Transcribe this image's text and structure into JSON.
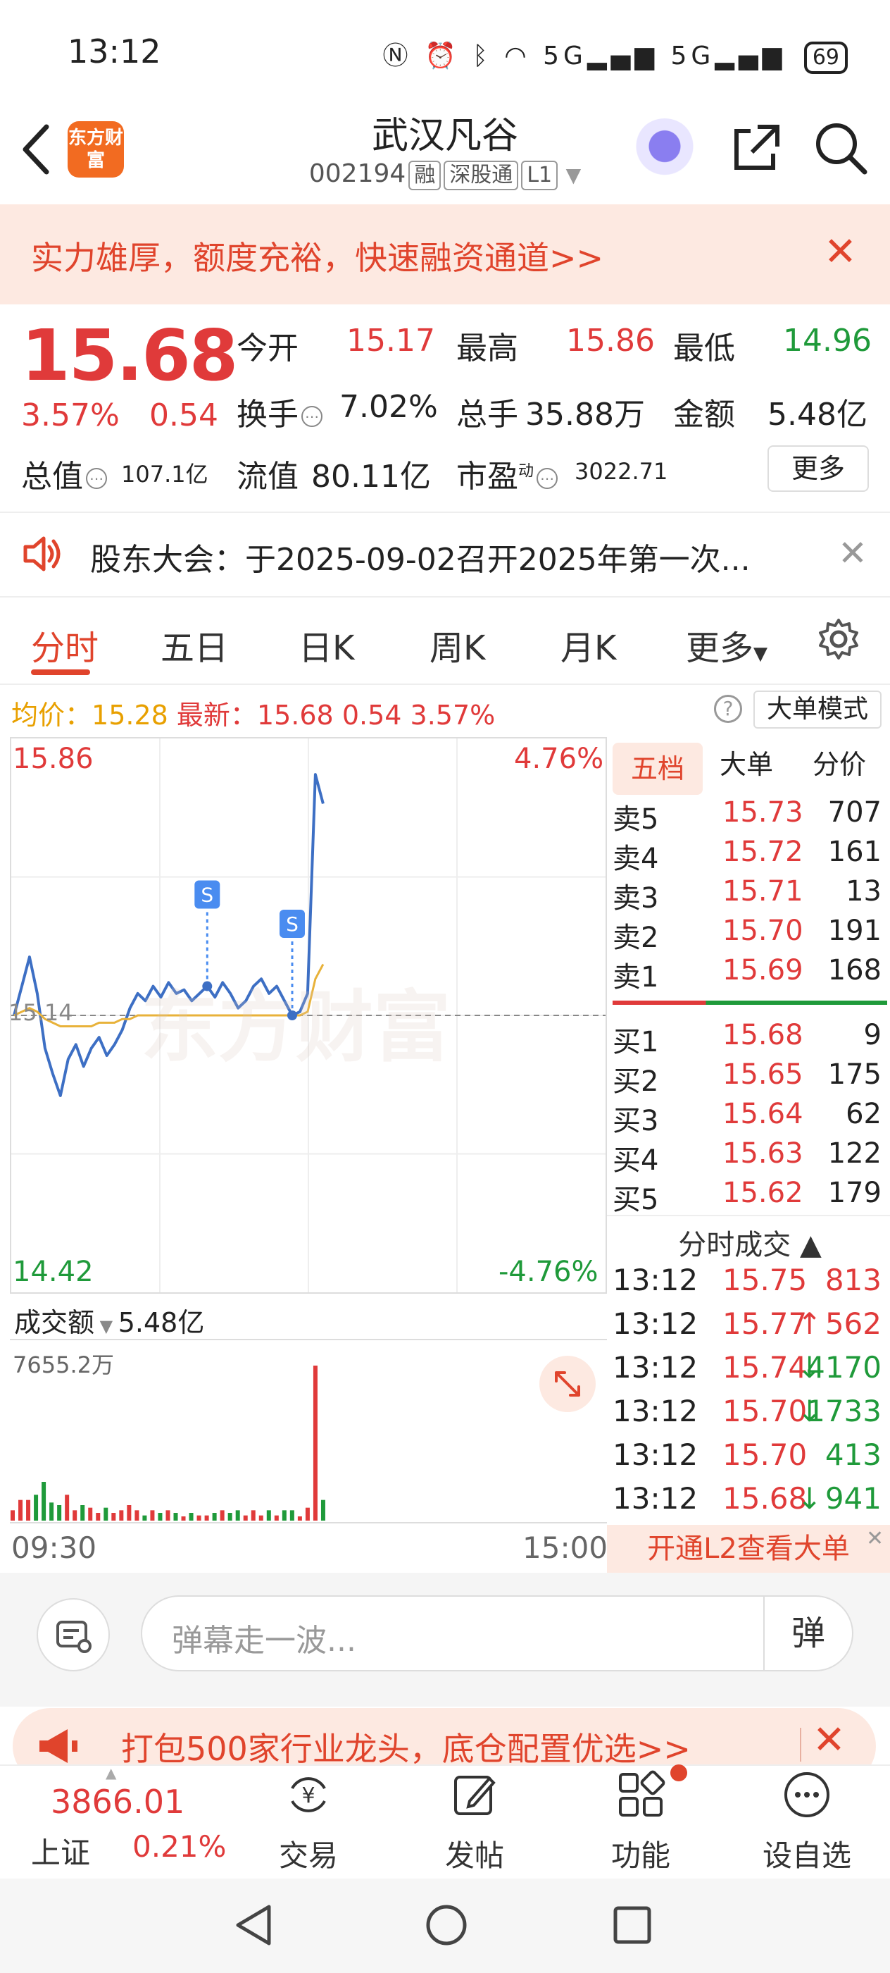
{
  "status_bar": {
    "time": "13:12",
    "battery": "69",
    "network": "5G"
  },
  "header": {
    "stock_name": "武汉凡谷",
    "code": "002194",
    "tags": [
      "融",
      "深股通",
      "L1"
    ],
    "logo_text": "东方财富"
  },
  "banner": {
    "text": "实力雄厚，额度充裕，快速融资通道>>"
  },
  "quote": {
    "price": "15.68",
    "pct": "3.57%",
    "change": "0.54",
    "open_label": "今开",
    "open": "15.17",
    "high_label": "最高",
    "high": "15.86",
    "low_label": "最低",
    "low": "14.96",
    "turnover_label": "换手",
    "turnover": "7.02%",
    "volume_label": "总手",
    "volume": "35.88万",
    "amount_label": "金额",
    "amount": "5.48亿",
    "mcap_label": "总值",
    "mcap": "107.1亿",
    "float_label": "流值",
    "float": "80.11亿",
    "pe_label": "市盈",
    "pe_sup": "动",
    "pe": "3022.71",
    "more": "更多"
  },
  "notice": {
    "text": "股东大会：于2025-09-02召开2025年第一次..."
  },
  "tabs": [
    "分时",
    "五日",
    "日K",
    "周K",
    "月K",
    "更多"
  ],
  "info_line": {
    "avg_label": "均价：",
    "avg": "15.28",
    "latest_label": "最新：",
    "latest": "15.68",
    "change": "0.54",
    "pct": "3.57%",
    "help": "?",
    "mode": "大单模式"
  },
  "chart": {
    "y_high": "15.86",
    "y_low": "14.42",
    "pct_high": "4.76%",
    "pct_low": "-4.76%",
    "ref": "15.14",
    "watermark": "东方财富",
    "marker": "S",
    "time_start": "09:30",
    "time_end": "15:00"
  },
  "chart_data": {
    "type": "line",
    "title": "",
    "xlabel": "",
    "ylabel": "",
    "x_range": [
      "09:30",
      "15:00"
    ],
    "ylim": [
      14.42,
      15.86
    ],
    "reference": 15.14,
    "series": [
      {
        "values": [
          15.14,
          15.22,
          15.3,
          15.2,
          15.05,
          14.98,
          14.92,
          15.02,
          15.06,
          15.0,
          15.05,
          15.08,
          15.03,
          15.06,
          15.1,
          15.16,
          15.2,
          15.18,
          15.22,
          15.19,
          15.23,
          15.2,
          15.21,
          15.18,
          15.2,
          15.22,
          15.19,
          15.23,
          15.2,
          15.16,
          15.18,
          15.22,
          15.24,
          15.2,
          15.22,
          15.18,
          15.14,
          15.15,
          15.2,
          15.8,
          15.72
        ]
      },
      {
        "values": [
          15.14,
          15.15,
          15.16,
          15.15,
          15.13,
          15.12,
          15.11,
          15.11,
          15.11,
          15.11,
          15.11,
          15.12,
          15.12,
          15.12,
          15.13,
          15.13,
          15.14,
          15.14,
          15.14,
          15.14,
          15.14,
          15.14,
          15.14,
          15.14,
          15.14,
          15.14,
          15.14,
          15.14,
          15.14,
          15.14,
          15.14,
          15.14,
          15.14,
          15.14,
          15.14,
          15.14,
          15.14,
          15.14,
          15.15,
          15.24,
          15.28
        ]
      }
    ],
    "volume_label": "成交额",
    "volume_total": "5.48亿",
    "volume_max": "7655.2万"
  },
  "order_book": {
    "tabs": [
      "五档",
      "大单",
      "分价"
    ],
    "asks": [
      {
        "label": "卖5",
        "price": "15.73",
        "vol": "707"
      },
      {
        "label": "卖4",
        "price": "15.72",
        "vol": "161"
      },
      {
        "label": "卖3",
        "price": "15.71",
        "vol": "13"
      },
      {
        "label": "卖2",
        "price": "15.70",
        "vol": "191"
      },
      {
        "label": "卖1",
        "price": "15.69",
        "vol": "168"
      }
    ],
    "bids": [
      {
        "label": "买1",
        "price": "15.68",
        "vol": "9"
      },
      {
        "label": "买2",
        "price": "15.65",
        "vol": "175"
      },
      {
        "label": "买3",
        "price": "15.64",
        "vol": "62"
      },
      {
        "label": "买4",
        "price": "15.63",
        "vol": "122"
      },
      {
        "label": "买5",
        "price": "15.62",
        "vol": "179"
      }
    ]
  },
  "ticks": {
    "title": "分时成交 ▲",
    "rows": [
      {
        "time": "13:12",
        "price": "15.75",
        "vol": "813",
        "dir": "",
        "color": "red"
      },
      {
        "time": "13:12",
        "price": "15.77",
        "vol": "562",
        "dir": "↑",
        "color": "red"
      },
      {
        "time": "13:12",
        "price": "15.74",
        "vol": "4170",
        "dir": "↓",
        "color": "green"
      },
      {
        "time": "13:12",
        "price": "15.70",
        "vol": "1733",
        "dir": "↓",
        "color": "green"
      },
      {
        "time": "13:12",
        "price": "15.70",
        "vol": "413",
        "dir": "",
        "color": "green"
      },
      {
        "time": "13:12",
        "price": "15.68",
        "vol": "941",
        "dir": "↓",
        "color": "green"
      }
    ],
    "l2": "开通L2查看大单"
  },
  "danmu": {
    "placeholder": "弹幕走一波...",
    "send": "弹"
  },
  "ad": {
    "text": "打包500家行业龙头，底仓配置优选>>"
  },
  "bottom_nav": {
    "index_value": "3866.01",
    "index_name": "上证",
    "index_pct": "0.21%",
    "items": [
      "交易",
      "发帖",
      "功能",
      "设自选"
    ]
  },
  "colors": {
    "red": "#e03a3a",
    "green": "#1f9a3a",
    "accent": "#e0442c"
  }
}
